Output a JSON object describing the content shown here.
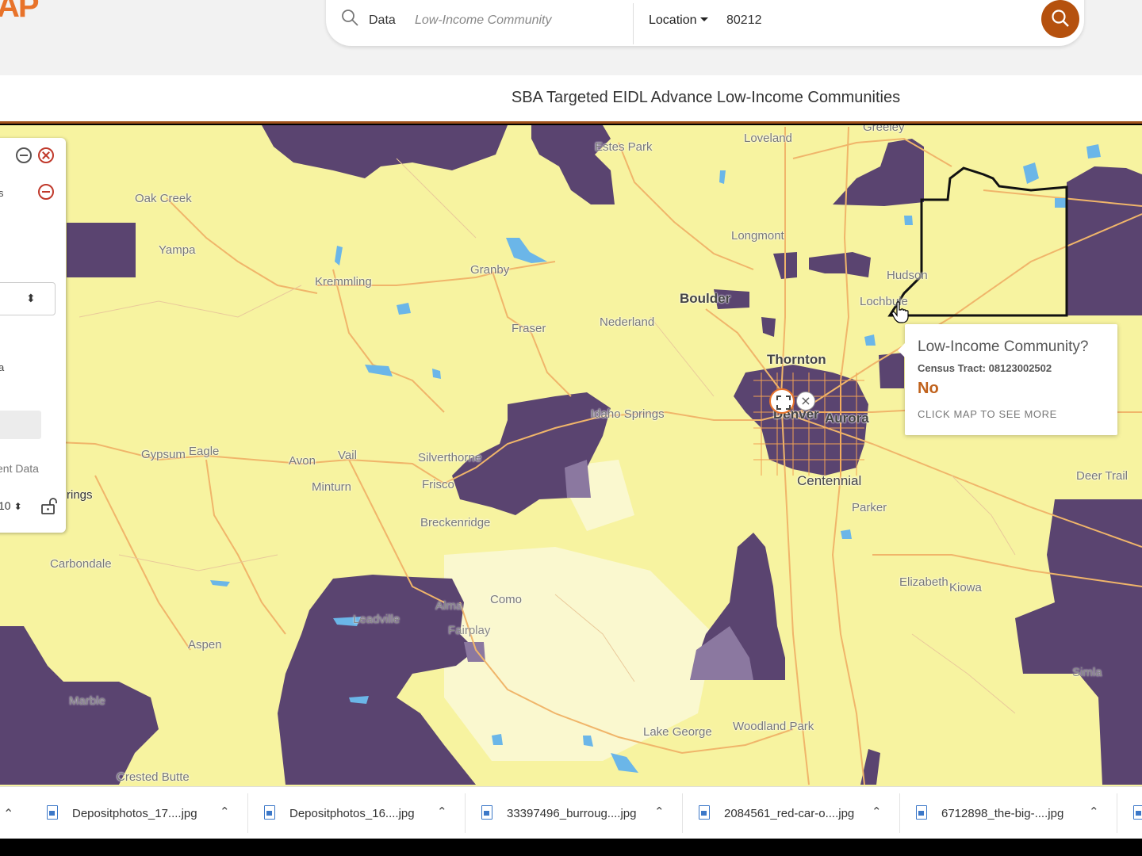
{
  "header": {
    "logo_text": "AP",
    "search": {
      "data_label": "Data",
      "data_placeholder": "Low-Income Community",
      "location_label": "Location",
      "location_value": "80212"
    },
    "title": "SBA Targeted EIDL Advance Low-Income Communities"
  },
  "side_panel": {
    "text_s": "s",
    "text_a": "a",
    "data_label": "ent Data",
    "year_value": "10"
  },
  "map": {
    "colors": {
      "base": "#f7f3a0",
      "low_income": "#5a4470",
      "roads": "#f0b56a",
      "water": "#6bb6e8",
      "boundary": "#111111"
    },
    "places": [
      "Oak Creek",
      "Yampa",
      "Kremmling",
      "Granby",
      "Estes Park",
      "Loveland",
      "Greeley",
      "Longmont",
      "Boulder",
      "Hudson",
      "Lochbuie",
      "Fraser",
      "Nederland",
      "Thornton",
      "Idaho Springs",
      "Denver",
      "Aurora",
      "Centennial",
      "Parker",
      "Deer Trail",
      "Gypsum",
      "Eagle",
      "Avon",
      "Vail",
      "Minturn",
      "Silverthorne",
      "Frisco",
      "Breckenridge",
      "Carbondale",
      "Aspen",
      "Leadville",
      "Alma",
      "Fairplay",
      "Como",
      "Elizabeth",
      "Kiowa",
      "Marble",
      "Crested Butte",
      "Lake George",
      "Woodland Park",
      "Simla",
      "rings"
    ]
  },
  "popup": {
    "title": "Low-Income Community?",
    "tract": "Census Tract: 08123002502",
    "answer": "No",
    "more": "CLICK MAP TO SEE MORE"
  },
  "downloads": [
    "Depositphotos_17....jpg",
    "Depositphotos_16....jpg",
    "33397496_burroug....jpg",
    "2084561_red-car-o....jpg",
    "6712898_the-big-....jpg"
  ]
}
